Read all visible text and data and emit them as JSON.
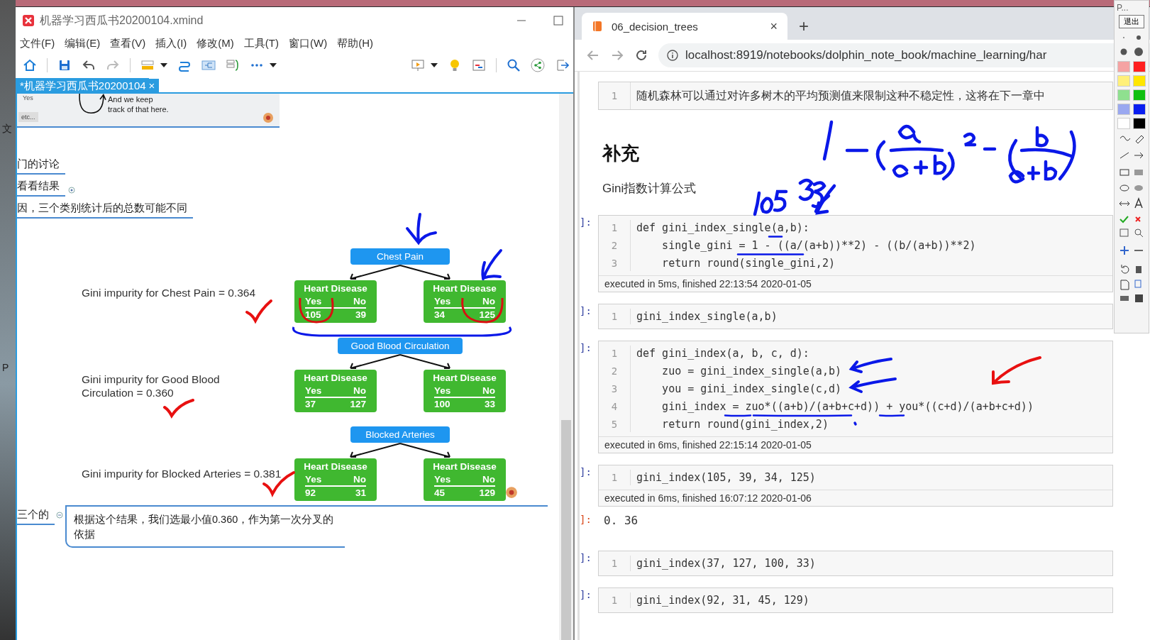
{
  "desktop": {
    "side_labels": [
      "文",
      "P"
    ]
  },
  "mindmap_window": {
    "title": "机器学习西瓜书20200104.xmind",
    "menu": [
      "文件(F)",
      "编辑(E)",
      "查看(V)",
      "插入(I)",
      "修改(M)",
      "工具(T)",
      "窗口(W)",
      "帮助(H)"
    ],
    "tab": {
      "label": "*机器学习西瓜书20200104",
      "close": "×"
    },
    "canvas": {
      "image_strip": {
        "yes": "Yes",
        "etc": "etc...",
        "note": "And we keep track of that here."
      },
      "topics": [
        {
          "label": "门的讨论",
          "marker": false
        },
        {
          "label": "看看结果",
          "marker": true
        },
        {
          "label": "因，三个类别统计后的总数可能不同",
          "marker": false
        }
      ],
      "figure": {
        "gini_lines": [
          "Gini impurity for Chest Pain = 0.364",
          "Gini impurity for Good Blood Circulation = 0.360",
          "Gini impurity for Blocked Arteries = 0.381"
        ],
        "trees": [
          {
            "root": "Chest Pain",
            "leaves": [
              {
                "title": "Heart Disease",
                "yes": "Yes",
                "no": "No",
                "yes_count": "105",
                "no_count": "39"
              },
              {
                "title": "Heart Disease",
                "yes": "Yes",
                "no": "No",
                "yes_count": "34",
                "no_count": "125"
              }
            ]
          },
          {
            "root": "Good Blood Circulation",
            "leaves": [
              {
                "title": "Heart Disease",
                "yes": "Yes",
                "no": "No",
                "yes_count": "37",
                "no_count": "127"
              },
              {
                "title": "Heart Disease",
                "yes": "Yes",
                "no": "No",
                "yes_count": "100",
                "no_count": "33"
              }
            ]
          },
          {
            "root": "Blocked Arteries",
            "leaves": [
              {
                "title": "Heart Disease",
                "yes": "Yes",
                "no": "No",
                "yes_count": "92",
                "no_count": "31"
              },
              {
                "title": "Heart Disease",
                "yes": "Yes",
                "no": "No",
                "yes_count": "45",
                "no_count": "129"
              }
            ]
          }
        ]
      },
      "branch_topic": "三个的",
      "note": "根据这个结果，我们选最小值0.360，作为第一次分叉的依据"
    }
  },
  "browser": {
    "tab_title": "06_decision_trees",
    "tab_close": "×",
    "new_tab": "+",
    "url": "localhost:8919/notebooks/dolphin_note_book/machine_learning/har"
  },
  "notebook": {
    "cells": [
      {
        "kind": "text",
        "lines": [
          {
            "n": "1",
            "code": "随机森林可以通过对许多树木的平均预测值来限制这种不稳定性，这将在下一章中"
          }
        ]
      },
      {
        "kind": "heading",
        "text": "补充"
      },
      {
        "kind": "paragraph",
        "text": "Gini指数计算公式"
      },
      {
        "kind": "code",
        "prompt": "]:",
        "lines": [
          {
            "n": "1",
            "code": "def gini_index_single(a,b):"
          },
          {
            "n": "2",
            "code": "    single_gini = 1 - ((a/(a+b))**2) - ((b/(a+b))**2)"
          },
          {
            "n": "3",
            "code": "    return round(single_gini,2)"
          }
        ],
        "footer": "executed in 5ms, finished 22:13:54 2020-01-05"
      },
      {
        "kind": "code",
        "prompt": "]:",
        "lines": [
          {
            "n": "1",
            "code": "gini_index_single(a,b)"
          }
        ]
      },
      {
        "kind": "code",
        "prompt": "]:",
        "lines": [
          {
            "n": "1",
            "code": "def gini_index(a, b, c, d):"
          },
          {
            "n": "2",
            "code": "    zuo = gini_index_single(a,b)"
          },
          {
            "n": "3",
            "code": "    you = gini_index_single(c,d)"
          },
          {
            "n": "4",
            "code": "    gini_index = zuo*((a+b)/(a+b+c+d)) + you*((c+d)/(a+b+c+d))"
          },
          {
            "n": "5",
            "code": "    return round(gini_index,2)"
          }
        ],
        "footer": "executed in 6ms, finished 22:15:14 2020-01-05"
      },
      {
        "kind": "code",
        "prompt": "]:",
        "lines": [
          {
            "n": "1",
            "code": "gini_index(105, 39, 34, 125)"
          }
        ],
        "footer": "executed in 6ms, finished 16:07:12 2020-01-06"
      },
      {
        "kind": "output",
        "prompt": "]:",
        "text": "0. 36"
      },
      {
        "kind": "code",
        "prompt": "]:",
        "lines": [
          {
            "n": "1",
            "code": "gini_index(37, 127, 100, 33)"
          }
        ]
      },
      {
        "kind": "code",
        "prompt": "]:",
        "lines": [
          {
            "n": "1",
            "code": "gini_index(92, 31, 45, 129)"
          }
        ]
      }
    ]
  },
  "annotator": {
    "title": "P...",
    "exit": "退出",
    "swatches": [
      {
        "color": "#f5a3a3"
      },
      {
        "color": "#ff2020"
      },
      {
        "color": "#fff07a"
      },
      {
        "color": "#ffe600"
      },
      {
        "color": "#8fe08f"
      },
      {
        "color": "#10c010"
      },
      {
        "color": "#9aa8f0"
      },
      {
        "color": "#0a1ef0"
      },
      {
        "color": "#ffffff"
      },
      {
        "color": "#000000"
      }
    ]
  }
}
